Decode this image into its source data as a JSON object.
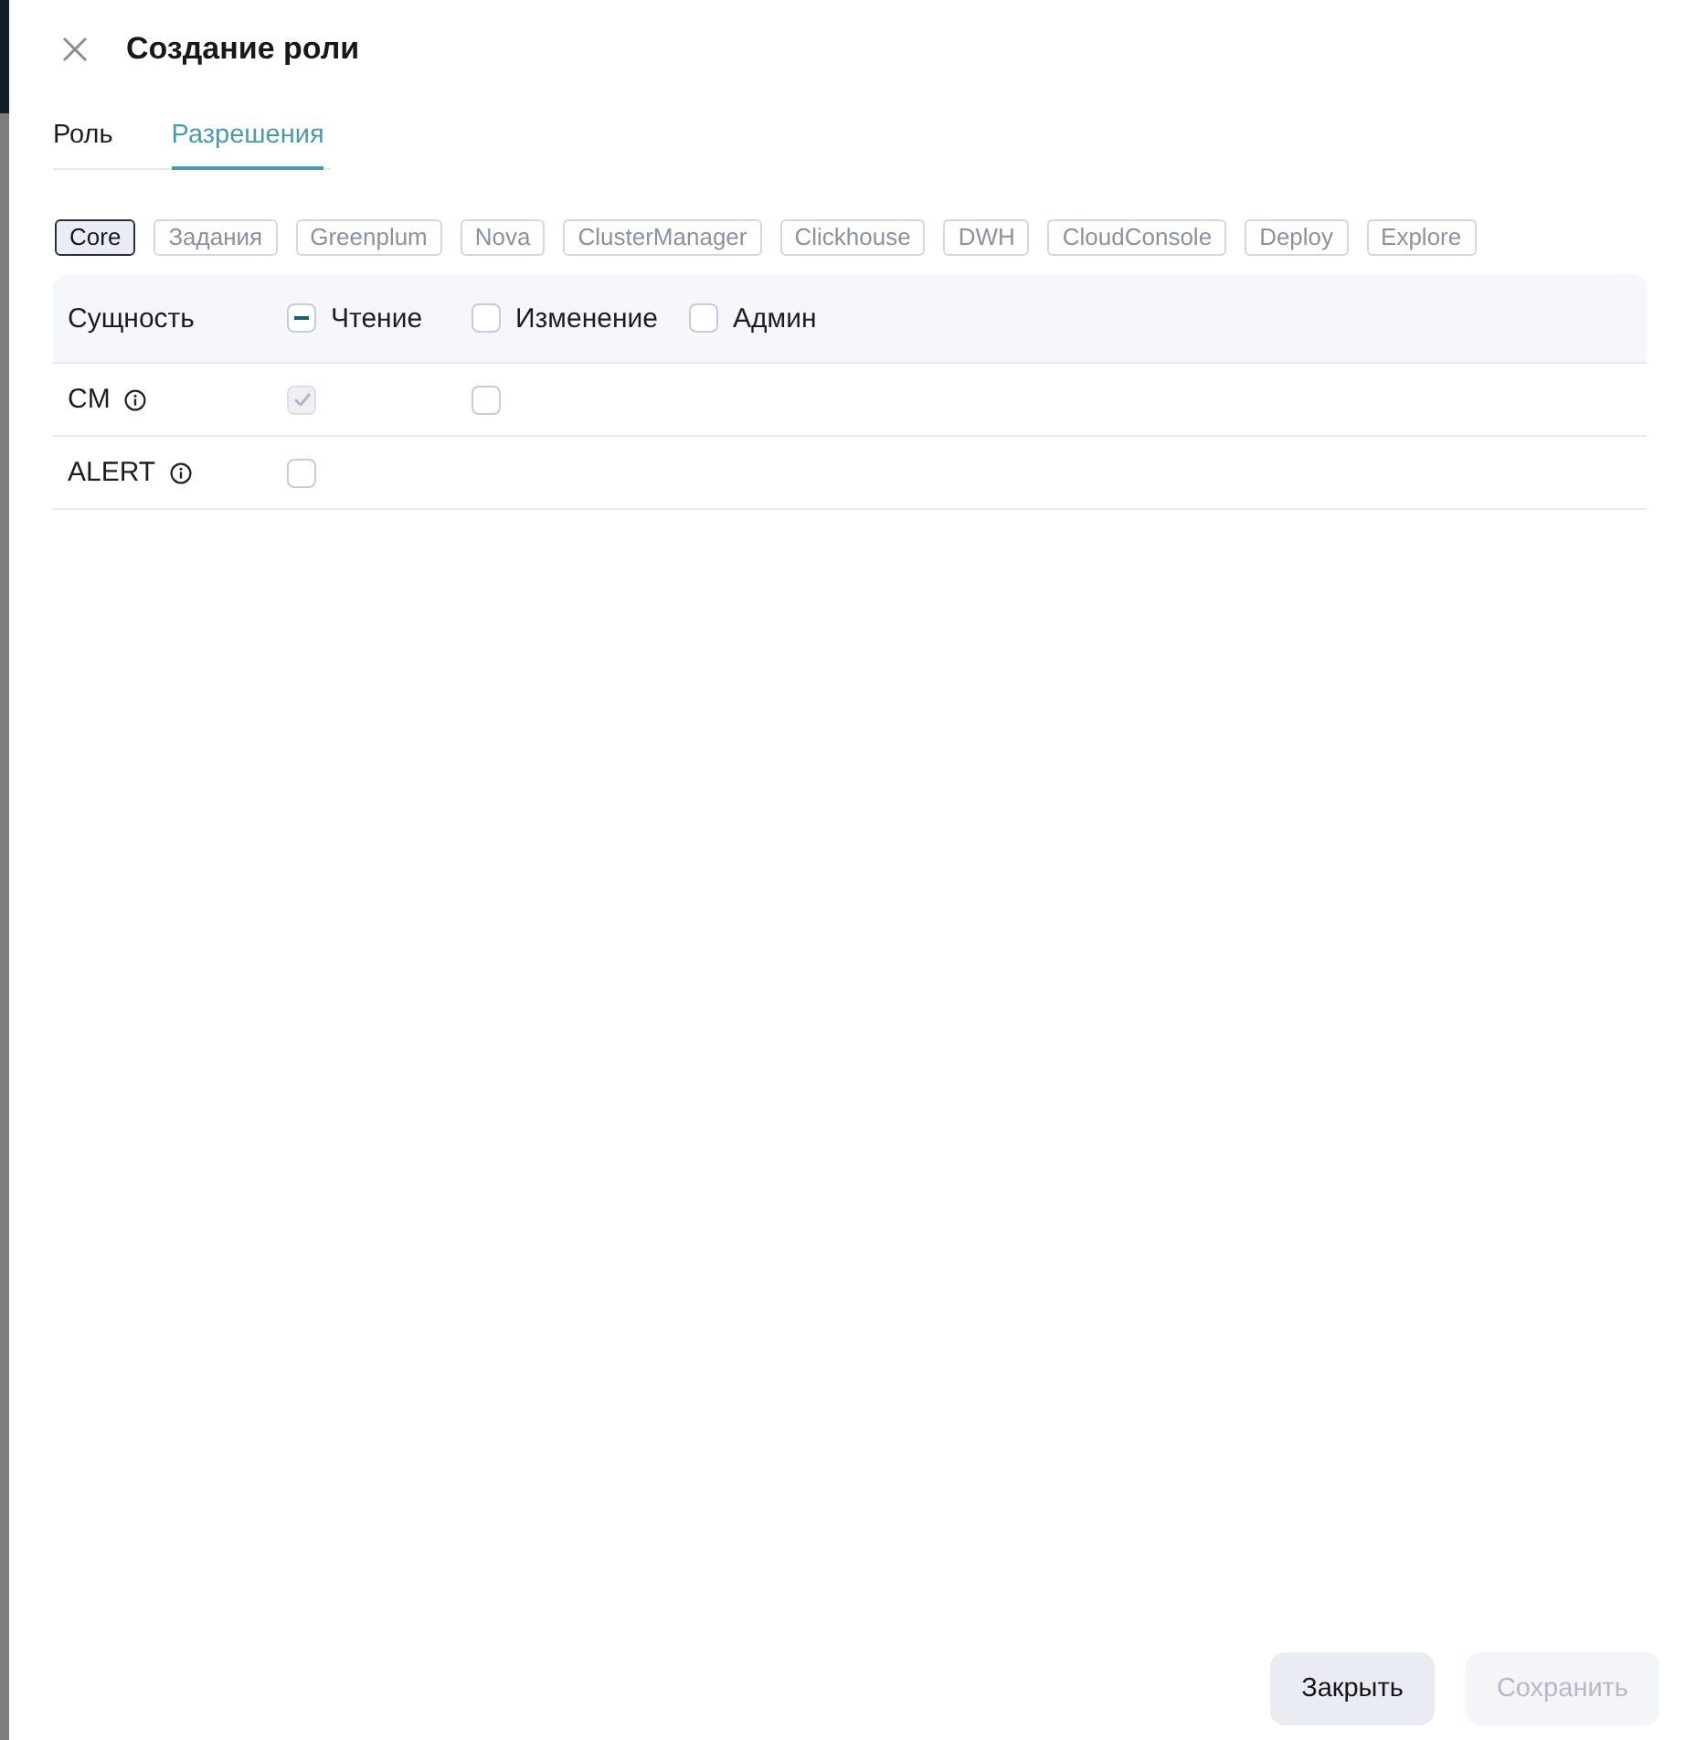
{
  "header": {
    "title": "Создание роли"
  },
  "tabs": [
    {
      "label": "Роль",
      "selected": false
    },
    {
      "label": "Разрешения",
      "selected": true
    }
  ],
  "services": [
    {
      "label": "Core",
      "selected": true
    },
    {
      "label": "Задания",
      "selected": false
    },
    {
      "label": "Greenplum",
      "selected": false
    },
    {
      "label": "Nova",
      "selected": false
    },
    {
      "label": "ClusterManager",
      "selected": false
    },
    {
      "label": "Clickhouse",
      "selected": false
    },
    {
      "label": "DWH",
      "selected": false
    },
    {
      "label": "CloudConsole",
      "selected": false
    },
    {
      "label": "Deploy",
      "selected": false
    },
    {
      "label": "Explore",
      "selected": false
    }
  ],
  "table": {
    "columns": [
      {
        "label": "Сущность"
      },
      {
        "label": "Чтение",
        "indeterminate": true
      },
      {
        "label": "Изменение",
        "indeterminate": false
      },
      {
        "label": "Админ",
        "indeterminate": false
      }
    ],
    "rows": [
      {
        "name": "CM",
        "cells": [
          {
            "checked": true,
            "disabled": true
          },
          {
            "checked": false,
            "disabled": false
          }
        ]
      },
      {
        "name": "ALERT",
        "cells": [
          {
            "checked": false,
            "disabled": false
          }
        ]
      }
    ]
  },
  "footer": {
    "buttons": [
      {
        "label": "Закрыть",
        "disabled": false
      },
      {
        "label": "Сохранить",
        "disabled": true
      }
    ]
  }
}
